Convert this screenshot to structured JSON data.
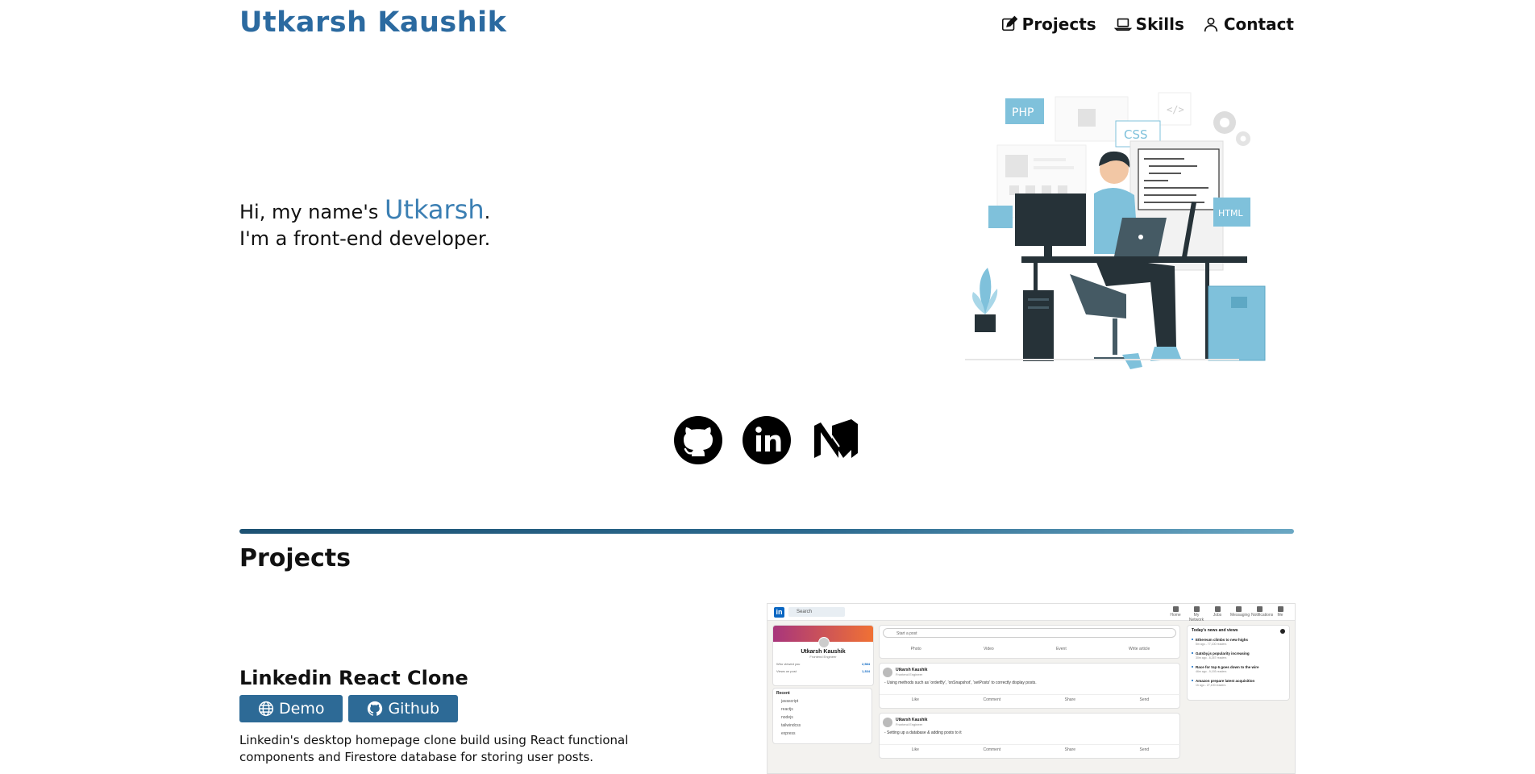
{
  "header": {
    "title": "Utkarsh Kaushik",
    "nav": [
      {
        "label": "Projects",
        "icon": "pencil-square-icon"
      },
      {
        "label": "Skills",
        "icon": "laptop-icon"
      },
      {
        "label": "Contact",
        "icon": "person-icon"
      }
    ]
  },
  "hero": {
    "greeting_prefix": "Hi, my name's ",
    "name": "Utkarsh",
    "greeting_suffix": ".",
    "tagline": "I'm a front-end developer.",
    "illustration_labels": {
      "php": "PHP",
      "css": "CSS",
      "html": "HTML"
    }
  },
  "social": [
    {
      "name": "github",
      "icon": "github-icon"
    },
    {
      "name": "linkedin",
      "icon": "linkedin-icon"
    },
    {
      "name": "medium",
      "icon": "medium-icon"
    }
  ],
  "colors": {
    "accent": "#2b6aa0",
    "button": "#2d6a96",
    "name_highlight": "#3b7fb3"
  },
  "projects": {
    "section_title": "Projects",
    "items": [
      {
        "title": "Linkedin React Clone",
        "demo_label": "Demo",
        "github_label": "Github",
        "description": "Linkedin's desktop homepage clone build using React functional components and Firestore database for storing user posts.",
        "screenshot": {
          "search": "Search",
          "nav": [
            "Home",
            "My Network",
            "Jobs",
            "Messaging",
            "Notifications",
            "Me"
          ],
          "profile_name": "Utkarsh Kaushik",
          "profile_role": "Frontend Engineer",
          "stats": [
            {
              "label": "Who viewed you",
              "value": "2,584"
            },
            {
              "label": "Views on post",
              "value": "1,334"
            }
          ],
          "recent_title": "Recent",
          "recent": [
            "javascript",
            "reactjs",
            "nodejs",
            "tailwindcss",
            "express"
          ],
          "start_post": "Start a post",
          "post_actions": [
            "Photo",
            "Video",
            "Event",
            "Write article"
          ],
          "posts": [
            {
              "name": "Utkarsh Kaushik",
              "role": "Frontend Engineer",
              "text": "- Using methods such as 'orderBy', 'onSnapshot', 'setPosts' to correctly display posts."
            },
            {
              "name": "Utkarsh Kaushik",
              "role": "Frontend Engineer",
              "text": "- Setting up a database & adding posts to it"
            }
          ],
          "reactions": [
            "Like",
            "Comment",
            "Share",
            "Send"
          ],
          "news_title": "Today's news and views",
          "news": [
            {
              "title": "Ethereum climbs to new highs",
              "meta": "5m ago - 77,100 readers"
            },
            {
              "title": "Gatsby.js popularity increasing",
              "meta": "30m ago - 6,267 readers"
            },
            {
              "title": "Race for top 6 goes down to the wire",
              "meta": "46m ago - 9,193 readers"
            },
            {
              "title": "Amazon prepare latest acquisition",
              "meta": "1h ago - 27,100 readers"
            }
          ]
        }
      }
    ]
  }
}
